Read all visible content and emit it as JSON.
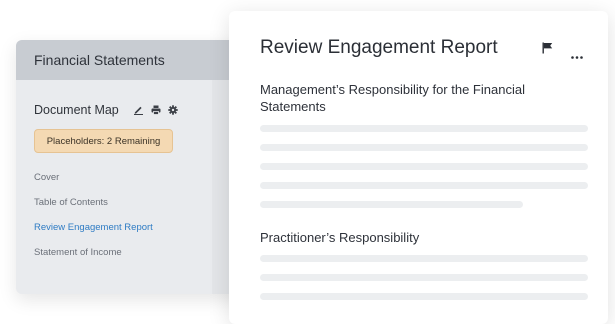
{
  "sidebar": {
    "header_title": "Financial Statements",
    "doc_map_title": "Document Map",
    "tools": [
      "edit-icon",
      "print-icon",
      "gear-icon"
    ],
    "placeholders": "Placeholders: 2 Remaining",
    "nav_items": [
      {
        "label": "Cover",
        "active": false
      },
      {
        "label": "Table of Contents",
        "active": false
      },
      {
        "label": "Review Engagement Report",
        "active": true
      },
      {
        "label": "Statement of Income",
        "active": false
      }
    ]
  },
  "report": {
    "title": "Review Engagement Report",
    "actions": [
      "flag-icon",
      "more-icon"
    ],
    "sections": [
      {
        "heading": "Management’s Responsibility for the Financial Statements"
      },
      {
        "heading": "Practitioner’s Responsibility"
      }
    ]
  },
  "colors": {
    "accent": "#2f7cc4",
    "badge_bg": "#f4d9b3",
    "header_bg": "#c8ccd2",
    "skeleton": "#eceef0"
  }
}
